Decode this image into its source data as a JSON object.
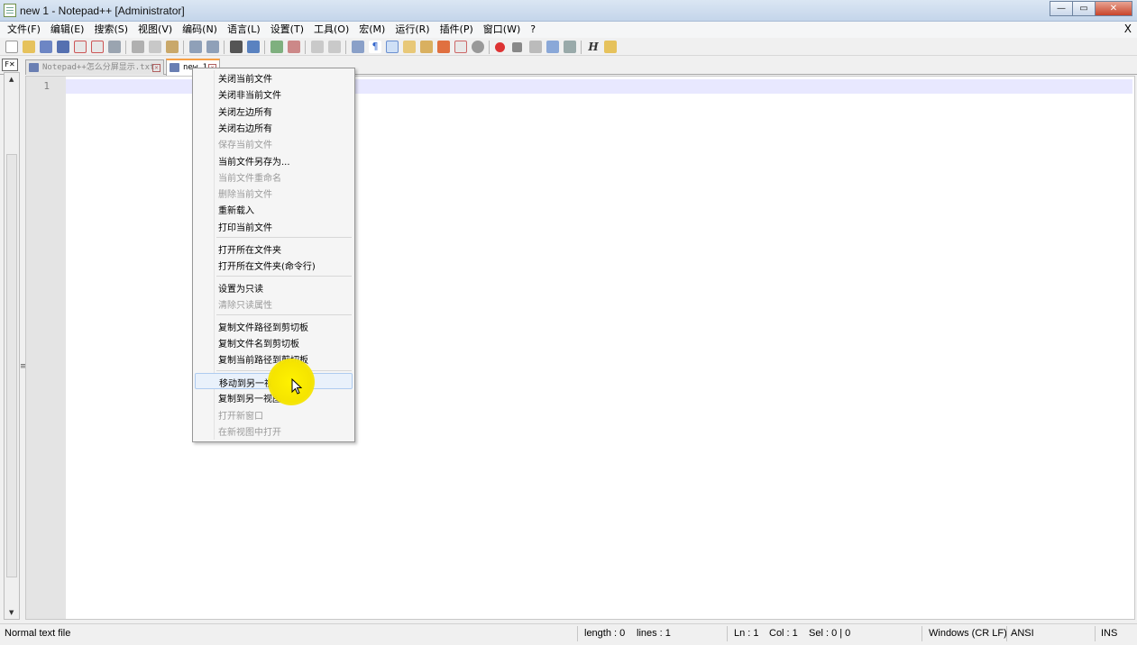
{
  "window": {
    "title": "new 1 - Notepad++ [Administrator]",
    "minimize": "—",
    "maximize": "▭",
    "close": "✕"
  },
  "menubar": {
    "items": [
      "文件(F)",
      "编辑(E)",
      "搜索(S)",
      "视图(V)",
      "编码(N)",
      "语言(L)",
      "设置(T)",
      "工具(O)",
      "宏(M)",
      "运行(R)",
      "插件(P)",
      "窗口(W)",
      "?"
    ],
    "close_doc": "X"
  },
  "tabs": [
    {
      "label": "Notepad++怎么分屏显示.txt",
      "active": false
    },
    {
      "label": "new 1",
      "active": true
    }
  ],
  "doc_switcher": "F✕",
  "editor": {
    "line_numbers": [
      "1"
    ]
  },
  "context_menu": {
    "groups": [
      [
        {
          "label": "关闭当前文件",
          "enabled": true
        },
        {
          "label": "关闭非当前文件",
          "enabled": true
        },
        {
          "label": "关闭左边所有",
          "enabled": true
        },
        {
          "label": "关闭右边所有",
          "enabled": true
        },
        {
          "label": "保存当前文件",
          "enabled": false
        },
        {
          "label": "当前文件另存为...",
          "enabled": true
        },
        {
          "label": "当前文件重命名",
          "enabled": false
        },
        {
          "label": "删除当前文件",
          "enabled": false
        },
        {
          "label": "重新载入",
          "enabled": true
        },
        {
          "label": "打印当前文件",
          "enabled": true
        }
      ],
      [
        {
          "label": "打开所在文件夹",
          "enabled": true
        },
        {
          "label": "打开所在文件夹(命令行)",
          "enabled": true
        }
      ],
      [
        {
          "label": "设置为只读",
          "enabled": true
        },
        {
          "label": "清除只读属性",
          "enabled": false
        }
      ],
      [
        {
          "label": "复制文件路径到剪切板",
          "enabled": true
        },
        {
          "label": "复制文件名到剪切板",
          "enabled": true
        },
        {
          "label": "复制当前路径到剪切板",
          "enabled": true
        }
      ],
      [
        {
          "label": "移动到另一视图",
          "enabled": true,
          "hover": true
        },
        {
          "label": "复制到另一视图",
          "enabled": true
        },
        {
          "label": "打开新窗口",
          "enabled": false
        },
        {
          "label": "在新视图中打开",
          "enabled": false
        }
      ]
    ]
  },
  "statusbar": {
    "file_type": "Normal text file",
    "length": "length : 0",
    "lines": "lines : 1",
    "ln": "Ln : 1",
    "col": "Col : 1",
    "sel": "Sel : 0 | 0",
    "eol": "Windows (CR LF)",
    "encoding": "ANSI",
    "mode": "INS"
  },
  "toolbar_icons": [
    "new-file-icon",
    "open-file-icon",
    "save-icon",
    "save-all-icon",
    "close-icon",
    "close-all-icon",
    "print-icon",
    "cut-icon",
    "copy-icon",
    "paste-icon",
    "undo-icon",
    "redo-icon",
    "find-icon",
    "replace-icon",
    "zoom-in-icon",
    "zoom-out-icon",
    "sync-vertical-icon",
    "sync-horizontal-icon",
    "word-wrap-icon",
    "show-all-chars-icon",
    "indent-guide-icon",
    "doc-map-icon",
    "function-list-icon",
    "folder-workspace-icon",
    "monitoring-icon",
    "panel-icon",
    "record-macro-icon",
    "stop-macro-icon",
    "play-macro-icon",
    "run-macro-multiple-icon",
    "save-macro-icon",
    "hex-h-icon",
    "spell-icon"
  ]
}
